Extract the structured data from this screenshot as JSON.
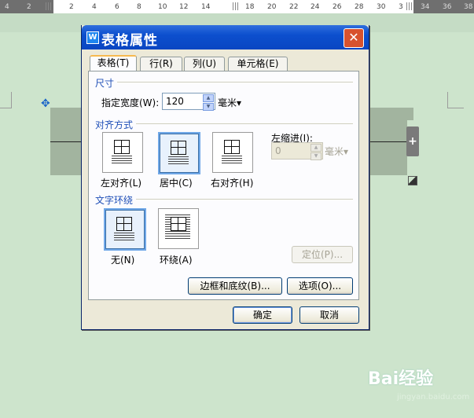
{
  "ruler": {
    "ticks": [
      "4",
      "2",
      "2",
      "4",
      "6",
      "8",
      "10",
      "12",
      "14",
      "18",
      "20",
      "22",
      "24",
      "26",
      "28",
      "30",
      "3",
      "34",
      "36",
      "38"
    ]
  },
  "dialog": {
    "title": "表格属性",
    "close_glyph": "✕",
    "app_icon_glyph": "W",
    "tabs": [
      "表格(T)",
      "行(R)",
      "列(U)",
      "单元格(E)"
    ],
    "size_section": {
      "heading": "尺寸",
      "width_label": "指定宽度(W):",
      "width_value": "120",
      "unit": "毫米▾"
    },
    "align_section": {
      "heading": "对齐方式",
      "options": [
        "左对齐(L)",
        "居中(C)",
        "右对齐(H)"
      ],
      "selected": "居中(C)",
      "indent_label": "左缩进(I):",
      "indent_value": "0",
      "indent_unit": "毫米▾"
    },
    "wrap_section": {
      "heading": "文字环绕",
      "options": [
        "无(N)",
        "环绕(A)"
      ],
      "selected": "无(N)",
      "position_button": "定位(P)..."
    },
    "borders_button": "边框和底纹(B)...",
    "options_button": "选项(O)...",
    "ok_button": "确定",
    "cancel_button": "取消"
  },
  "table_handle_glyph": "+",
  "move_handle_glyph": "✥",
  "watermark": {
    "brand": "Bai经验",
    "url": "jingyan.baidu.com"
  },
  "colors": {
    "page_bg": "#cde4cc",
    "title_bar": "#0c4fce",
    "accent": "#1f4fb7"
  }
}
